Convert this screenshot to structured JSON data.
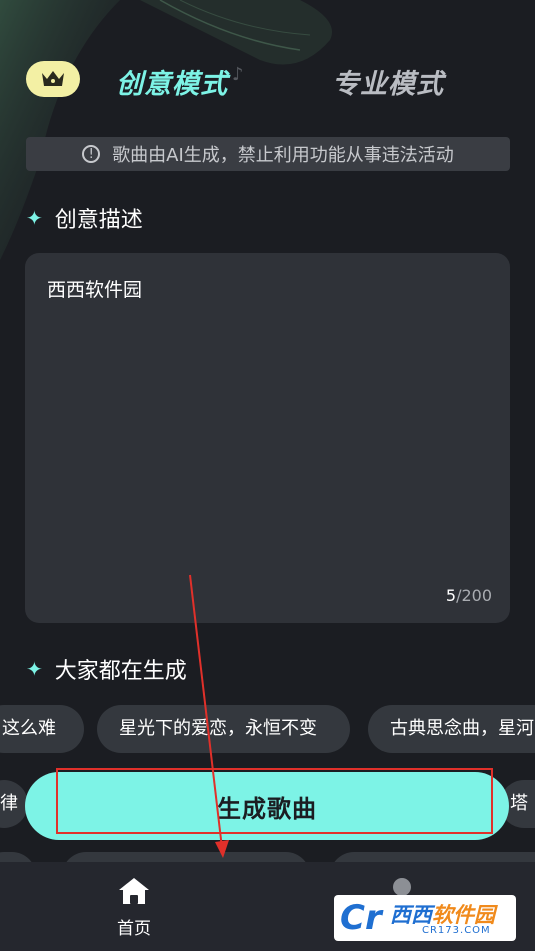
{
  "header": {
    "tabs": [
      {
        "label": "创意模式",
        "active": true
      },
      {
        "label": "专业模式",
        "active": false
      }
    ]
  },
  "notice": {
    "text": "歌曲由AI生成，禁止利用功能从事违法活动"
  },
  "creative_section": {
    "title": "创意描述"
  },
  "description": {
    "value": "西西软件园",
    "count": "5",
    "max": "/200"
  },
  "popular_section": {
    "title": "大家都在生成"
  },
  "chips_row1": [
    "这么难",
    "星光下的爱恋，永恒不变",
    "古典思念曲，星河"
  ],
  "chips_row2": [
    "律",
    "塔"
  ],
  "generate_button": {
    "label": "生成歌曲"
  },
  "bottom_nav": {
    "home_label": "首页"
  },
  "watermark": {
    "brand_blue": "西西",
    "brand_orange": "软件园",
    "domain": "CR173.COM",
    "logo": "Cr"
  },
  "colors": {
    "accent": "#7df3e6",
    "background": "#1b1d22",
    "annotation": "#e0302a"
  }
}
